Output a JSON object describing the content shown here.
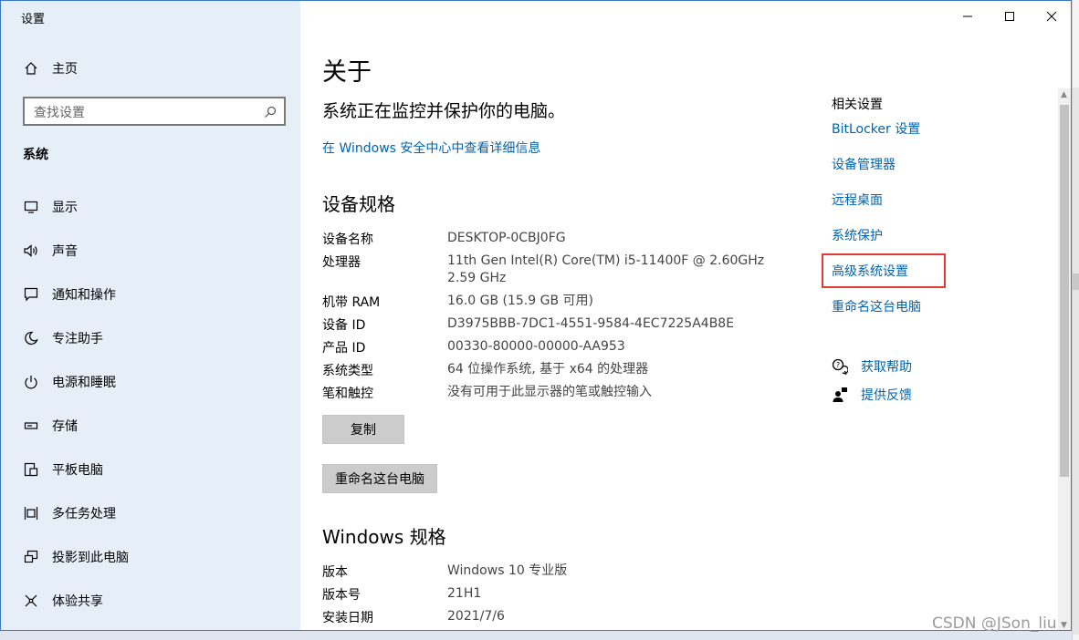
{
  "window": {
    "title": "设置",
    "controls": [
      "minimize",
      "maximize",
      "close"
    ]
  },
  "sidebar": {
    "home_label": "主页",
    "search_placeholder": "查找设置",
    "section_label": "系统",
    "items": [
      {
        "label": "显示",
        "icon": "monitor-icon"
      },
      {
        "label": "声音",
        "icon": "speaker-icon"
      },
      {
        "label": "通知和操作",
        "icon": "notification-icon"
      },
      {
        "label": "专注助手",
        "icon": "moon-icon"
      },
      {
        "label": "电源和睡眠",
        "icon": "power-icon"
      },
      {
        "label": "存储",
        "icon": "storage-icon"
      },
      {
        "label": "平板电脑",
        "icon": "tablet-icon"
      },
      {
        "label": "多任务处理",
        "icon": "multitask-icon"
      },
      {
        "label": "投影到此电脑",
        "icon": "project-icon"
      },
      {
        "label": "体验共享",
        "icon": "share-icon"
      }
    ]
  },
  "main": {
    "title": "关于",
    "status": "系统正在监控并保护你的电脑。",
    "security_link": "在 Windows 安全中心中查看详细信息",
    "device_specs": {
      "heading": "设备规格",
      "rows": [
        {
          "key": "设备名称",
          "value": "DESKTOP-0CBJ0FG"
        },
        {
          "key": "处理器",
          "value": "11th Gen Intel(R) Core(TM) i5-11400F @ 2.60GHz",
          "value2": "2.59 GHz"
        },
        {
          "key": "机带 RAM",
          "value": "16.0 GB (15.9 GB 可用)"
        },
        {
          "key": "设备 ID",
          "value": "D3975BBB-7DC1-4551-9584-4EC7225A4B8E"
        },
        {
          "key": "产品 ID",
          "value": "00330-80000-00000-AA953"
        },
        {
          "key": "系统类型",
          "value": "64 位操作系统, 基于 x64 的处理器"
        },
        {
          "key": "笔和触控",
          "value": "没有可用于此显示器的笔或触控输入"
        }
      ],
      "copy_button": "复制",
      "rename_button": "重命名这台电脑"
    },
    "windows_specs": {
      "heading": "Windows 规格",
      "rows": [
        {
          "key": "版本",
          "value": "Windows 10 专业版"
        },
        {
          "key": "版本号",
          "value": "21H1"
        },
        {
          "key": "安装日期",
          "value": "2021/7/6"
        }
      ]
    }
  },
  "related": {
    "heading": "相关设置",
    "links": [
      "BitLocker 设置",
      "设备管理器",
      "远程桌面",
      "系统保护",
      "高级系统设置",
      "重命名这台电脑"
    ],
    "highlighted_link": "高级系统设置",
    "help": {
      "label": "获取帮助",
      "icon": "help-chat-icon"
    },
    "feedback": {
      "label": "提供反馈",
      "icon": "feedback-icon"
    }
  },
  "watermark": "CSDN @JSon_liu",
  "colors": {
    "sidebar_bg": "#e6eef8",
    "link": "#0063b1",
    "highlight_border": "#e53935",
    "button_bg": "#cccccc"
  }
}
